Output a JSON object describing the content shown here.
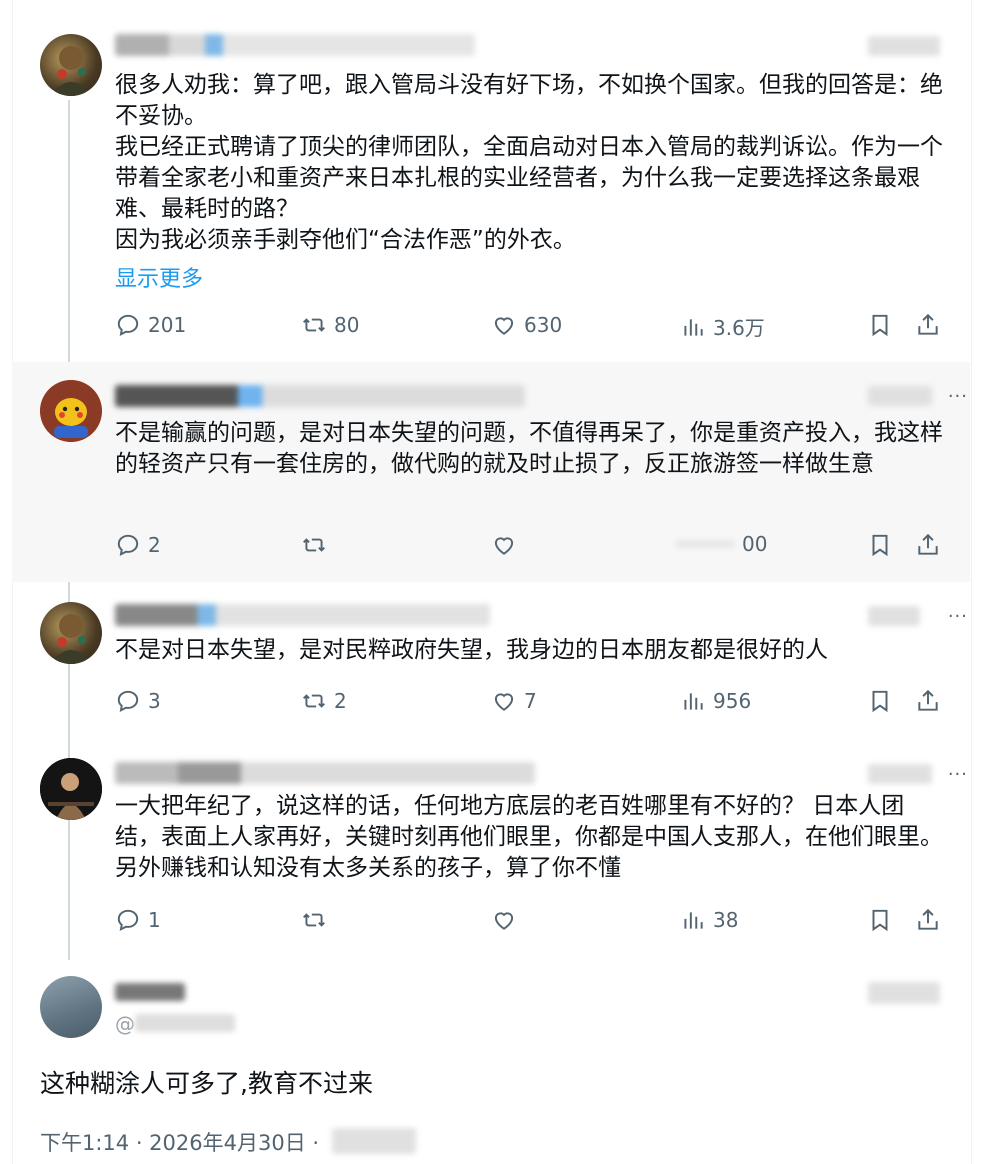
{
  "posts": [
    {
      "text": "很多人劝我：算了吧，跟入管局斗没有好下场，不如换个国家。但我的回答是：绝不妥协。\n我已经正式聘请了顶尖的律师团队，全面启动对日本入管局的裁判诉讼。作为一个带着全家老小和重资产来日本扎根的实业经营者，为什么我一定要选择这条最艰难、最耗时的路？\n因为我必须亲手剥夺他们“合法作恶”的外衣。",
      "show_more": "显示更多",
      "replies": "201",
      "reposts": "80",
      "likes": "630",
      "views": "3.6万"
    },
    {
      "text": "不是输赢的问题，是对日本失望的问题，不值得再呆了，你是重资产投入，我这样的轻资产只有一套住房的，做代购的就及时止损了，反正旅游签一样做生意",
      "replies": "2",
      "reposts": "",
      "likes": "",
      "views": "00"
    },
    {
      "text": "不是对日本失望，是对民粹政府失望，我身边的日本朋友都是很好的人",
      "replies": "3",
      "reposts": "2",
      "likes": "7",
      "views": "956"
    },
    {
      "text": "一大把年纪了，说这样的话，任何地方底层的老百姓哪里有不好的？ 日本人团结，表面上人家再好，关键时刻再他们眼里，你都是中国人支那人，在他们眼里。 另外赚钱和认知没有太多关系的孩子，算了你不懂",
      "replies": "1",
      "reposts": "",
      "likes": "",
      "views": "38"
    }
  ],
  "main_post": {
    "handle_prefix": "@",
    "text": "这种糊涂人可多了,教育不过来",
    "timestamp": "下午1:14 · 2026年4月30日 ·"
  },
  "more_label": "···",
  "icons": [
    "reply-icon",
    "repost-icon",
    "like-icon",
    "views-icon",
    "bookmark-icon",
    "share-icon"
  ],
  "colors": {
    "accent": "#1d9bf0",
    "muted": "#536471",
    "text": "#0f1419",
    "highlight": "#f7f7f7"
  }
}
